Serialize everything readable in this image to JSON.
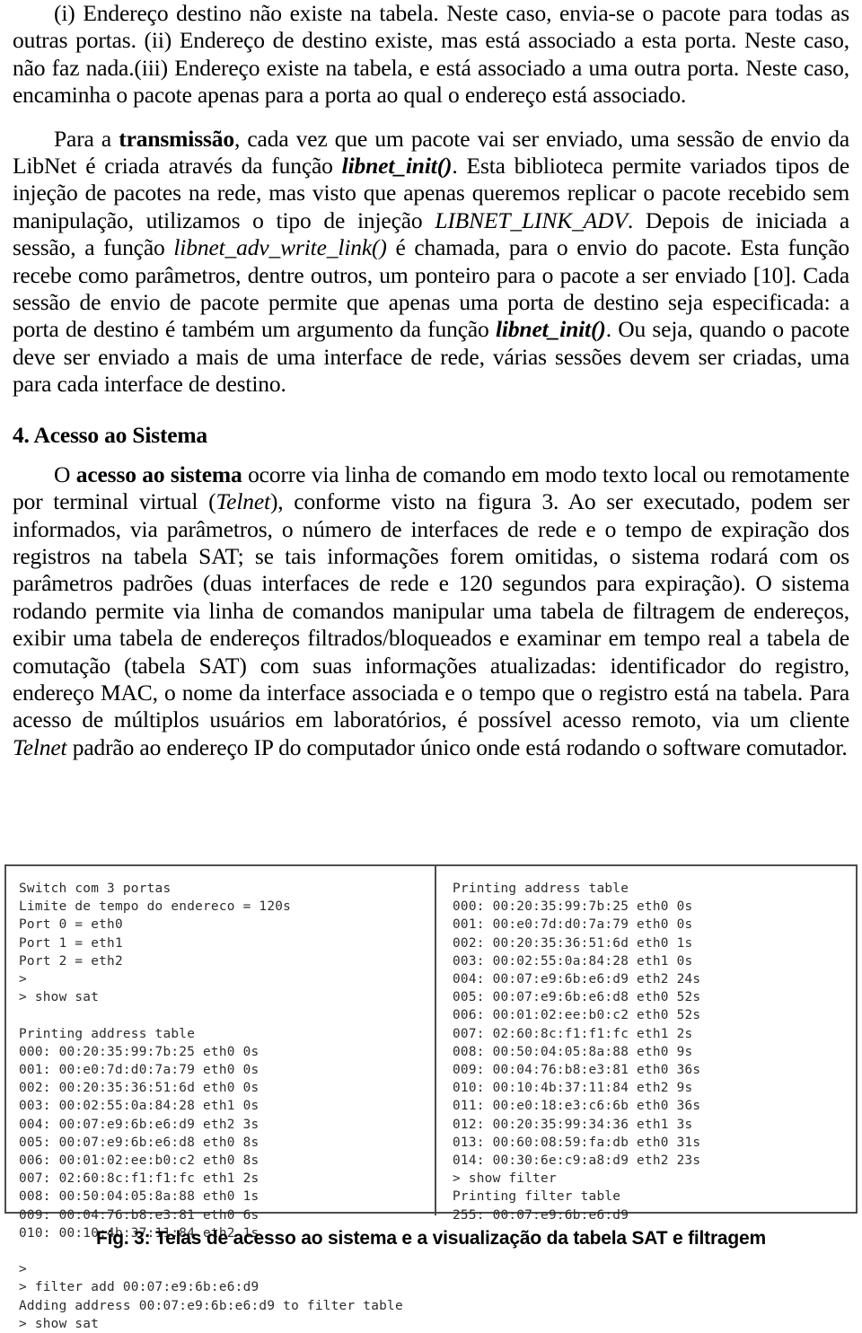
{
  "document": {
    "paragraphs": [
      {
        "id": "p1",
        "indent": true,
        "runs": [
          {
            "text": "(i) Endereço destino não existe na tabela. Neste caso, envia-se o pacote para todas as outras portas. (ii) Endereço de destino existe, mas está associado a esta porta. Neste caso, não faz nada.(iii) Endereço existe na tabela, e está associado a uma outra porta. Neste caso, encaminha o pacote apenas para a porta ao qual o endereço está associado.",
            "style": "normal"
          }
        ]
      },
      {
        "id": "p2",
        "indent": true,
        "runs": [
          {
            "text": "Para a ",
            "style": "normal"
          },
          {
            "text": "transmissão",
            "style": "bold"
          },
          {
            "text": ", cada vez que um pacote vai ser enviado, uma sessão de envio da LibNet é criada através da função ",
            "style": "normal"
          },
          {
            "text": "libnet_init()",
            "style": "bold-italic"
          },
          {
            "text": ". Esta biblioteca permite variados tipos de injeção de pacotes na rede, mas visto que apenas queremos replicar o pacote recebido sem manipulação, utilizamos o tipo de injeção ",
            "style": "normal"
          },
          {
            "text": "LIBNET_LINK_ADV",
            "style": "italic"
          },
          {
            "text": ". Depois de iniciada a sessão, a função ",
            "style": "normal"
          },
          {
            "text": "libnet_adv_write_link()",
            "style": "italic"
          },
          {
            "text": " é chamada, para o envio do pacote. Esta função recebe como parâmetros, dentre outros, um ponteiro para o pacote a ser enviado [10]. Cada sessão de envio de pacote permite que apenas uma porta de destino seja especificada: a porta de destino é também um argumento da função ",
            "style": "normal"
          },
          {
            "text": "libnet_init()",
            "style": "bold-italic"
          },
          {
            "text": ". Ou seja, quando o pacote deve ser enviado a mais de uma interface de rede, várias sessões devem ser criadas, uma para cada interface de destino.",
            "style": "normal"
          }
        ]
      }
    ],
    "heading": "4. Acesso ao Sistema",
    "paragraphs_after_heading": [
      {
        "id": "p3",
        "indent": true,
        "runs": [
          {
            "text": "O ",
            "style": "normal"
          },
          {
            "text": "acesso ao sistema",
            "style": "bold"
          },
          {
            "text": " ocorre via linha de comando em modo texto local ou remotamente por terminal virtual (",
            "style": "normal"
          },
          {
            "text": "Telnet",
            "style": "italic"
          },
          {
            "text": "), conforme visto na figura 3. Ao ser executado, podem ser informados, via parâmetros, o número de interfaces de rede e o tempo de expiração dos registros na tabela SAT; se tais informações forem omitidas, o sistema rodará com os parâmetros padrões (duas interfaces de rede e 120 segundos para expiração). O sistema rodando permite via linha de comandos manipular uma tabela de filtragem de endereços, exibir uma tabela de endereços filtrados/bloqueados e examinar em tempo real a tabela de comutação (tabela SAT) com suas informações atualizadas: identificador do registro, endereço MAC, o nome da interface associada e o tempo que o registro está na tabela. Para acesso de múltiplos usuários em laboratórios, é possível acesso remoto, via um cliente ",
            "style": "normal"
          },
          {
            "text": "Telnet",
            "style": "italic"
          },
          {
            "text": " padrão ao endereço IP do computador único onde está rodando o software comutador.",
            "style": "normal"
          }
        ]
      }
    ]
  },
  "figure": {
    "caption": "Fig. 3: Telas de acesso ao sistema e a visualização da tabela SAT e filtragem",
    "terminal_left": {
      "lines": [
        "Switch com 3 portas",
        "Limite de tempo do endereco = 120s",
        "Port 0 = eth0",
        "Port 1 = eth1",
        "Port 2 = eth2",
        ">",
        "> show sat",
        "",
        "Printing address table",
        "000: 00:20:35:99:7b:25 eth0 0s",
        "001: 00:e0:7d:d0:7a:79 eth0 0s",
        "002: 00:20:35:36:51:6d eth0 0s",
        "003: 00:02:55:0a:84:28 eth1 0s",
        "004: 00:07:e9:6b:e6:d9 eth2 3s",
        "005: 00:07:e9:6b:e6:d8 eth0 8s",
        "006: 00:01:02:ee:b0:c2 eth0 8s",
        "007: 02:60:8c:f1:f1:fc eth1 2s",
        "008: 00:50:04:05:8a:88 eth0 1s",
        "009: 00:04:76:b8:e3:81 eth0 6s",
        "010: 00:10:4b:37:11:84 eth2 1s",
        "",
        ">",
        "> filter add 00:07:e9:6b:e6:d9",
        "Adding address 00:07:e9:6b:e6:d9 to filter table",
        "> show sat"
      ]
    },
    "terminal_right": {
      "lines": [
        "Printing address table",
        "000: 00:20:35:99:7b:25 eth0 0s",
        "001: 00:e0:7d:d0:7a:79 eth0 0s",
        "002: 00:20:35:36:51:6d eth0 1s",
        "003: 00:02:55:0a:84:28 eth1 0s",
        "004: 00:07:e9:6b:e6:d9 eth2 24s",
        "005: 00:07:e9:6b:e6:d8 eth0 52s",
        "006: 00:01:02:ee:b0:c2 eth0 52s",
        "007: 02:60:8c:f1:f1:fc eth1 2s",
        "008: 00:50:04:05:8a:88 eth0 9s",
        "009: 00:04:76:b8:e3:81 eth0 36s",
        "010: 00:10:4b:37:11:84 eth2 9s",
        "011: 00:e0:18:e3:c6:6b eth0 36s",
        "012: 00:20:35:99:34:36 eth1 3s",
        "013: 00:60:08:59:fa:db eth0 31s",
        "014: 00:30:6e:c9:a8:d9 eth2 23s",
        "> show filter",
        "Printing filter table",
        "255: 00:07:e9:6b:e6:d9"
      ]
    }
  }
}
